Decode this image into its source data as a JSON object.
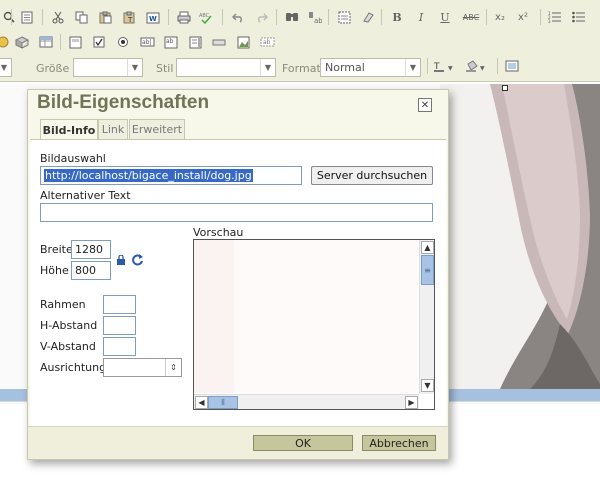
{
  "toolbar": {
    "row1_icons": [
      "find-replace-icon",
      "document-icon",
      "cut-icon",
      "copy-icon",
      "paste-icon",
      "paste-text-icon",
      "paste-word-icon",
      "print-icon",
      "spellcheck-icon",
      "undo-icon",
      "redo-icon",
      "find-icon",
      "replace-icon",
      "select-all-icon",
      "remove-format-icon",
      "bold-icon",
      "italic-icon",
      "underline-icon",
      "strikethrough-icon",
      "subscript-icon",
      "superscript-icon",
      "ordered-list-icon",
      "unordered-list-icon"
    ],
    "bold_glyph": "B",
    "italic_glyph": "I",
    "underline_glyph": "U",
    "strike_glyph": "ABC",
    "sub_glyph": "x₂",
    "sup_glyph": "x²",
    "groesse_label": "Größe",
    "stil_label": "Stil",
    "format_label": "Format",
    "format_value": "Normal"
  },
  "dialog": {
    "title": "Bild-Eigenschaften",
    "tabs": [
      "Bild-Info",
      "Link",
      "Erweitert"
    ],
    "active_tab": "Bild-Info",
    "bildauswahl_label": "Bildauswahl",
    "url_value": "http://localhost/bigace_install/dog.jpg",
    "server_button": "Server durchsuchen",
    "alt_label": "Alternativer Text",
    "alt_value": "",
    "breite_label": "Breite",
    "breite_value": "1280",
    "hoehe_label": "Höhe",
    "hoehe_value": "800",
    "rahmen_label": "Rahmen",
    "h_abstand_label": "H-Abstand",
    "v_abstand_label": "V-Abstand",
    "ausrichtung_label": "Ausrichtung",
    "vorschau_label": "Vorschau",
    "ok_label": "OK",
    "cancel_label": "Abbrechen"
  },
  "colors": {
    "dialog_bg": "#f7f7ea",
    "title": "#737357",
    "footer_button": "#c6c69d",
    "toolbar_bg": "#efefde",
    "selection": "#3569c5"
  }
}
